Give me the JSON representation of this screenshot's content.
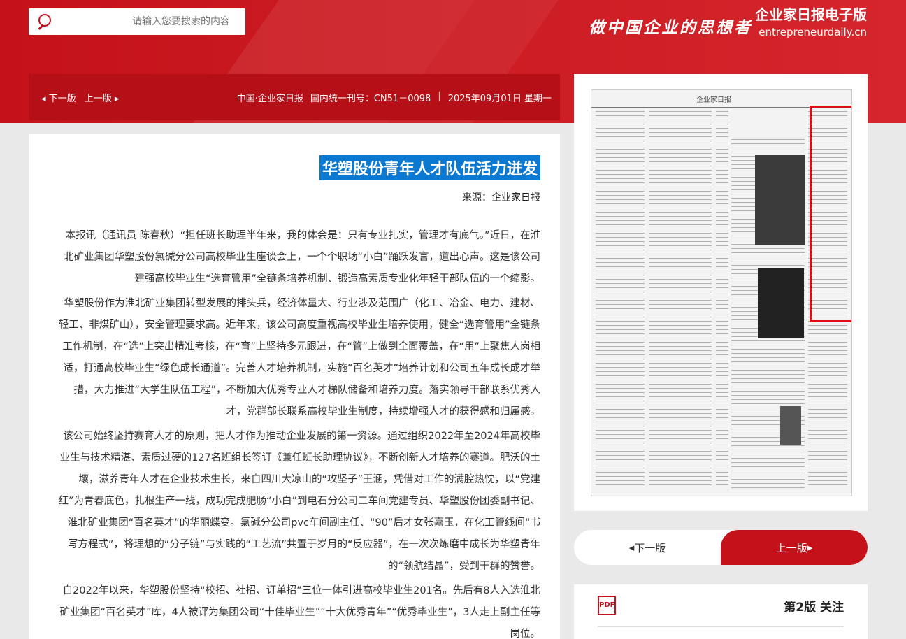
{
  "header": {
    "search_placeholder": "请输入您要搜索的内容",
    "brand_name": "企业家日报电子版",
    "brand_domain": "entrepreneurdaily.cn",
    "slogan": "做中国企业的思想者"
  },
  "infobar": {
    "prev_label": "上一版",
    "next_label": "下一版",
    "date": "2025年09月01日 星期一",
    "issn": "国内统一刊号：CN51－0098",
    "paper": "中国·企业家日报"
  },
  "article": {
    "title": "华塑股份青年人才队伍活力迸发",
    "source": "来源：企业家日报",
    "paragraphs": [
      "本报讯（通讯员 陈春秋）“担任班长助理半年来，我的体会是：只有专业扎实，管理才有底气。”近日，在淮北矿业集团华塑股份氯碱分公司高校毕业生座谈会上，一个个职场“小白”踊跃发言，道出心声。这是该公司建强高校毕业生“选育管用”全链条培养机制、锻造高素质专业化年轻干部队伍的一个缩影。",
      "华塑股份作为淮北矿业集团转型发展的排头兵，经济体量大、行业涉及范围广（化工、冶金、电力、建材、轻工、非煤矿山），安全管理要求高。近年来，该公司高度重视高校毕业生培养使用，健全“选育管用”全链条工作机制，在“选”上突出精准考核，在“育”上坚持多元跟进，在“管”上做到全面覆盖，在“用”上聚焦人岗相适，打通高校毕业生“绿色成长通道”。完善人才培养机制，实施“百名英才”培养计划和公司五年成长成才举措，大力推进“大学生队伍工程”，不断加大优秀专业人才梯队储备和培养力度。落实领导干部联系优秀人才，党群部长联系高校毕业生制度，持续增强人才的获得感和归属感。",
      "该公司始终坚持赛育人才的原则，把人才作为推动企业发展的第一资源。通过组织2022年至2024年高校毕业生与技术精湛、素质过硬的127名班组长签订《兼任班长助理协议》，不断创新人才培养的赛道。肥沃的土壤，滋养青年人才在企业技术生长，来自四川大凉山的“攻坚子”王涵，凭借对工作的满腔热忱，以“党建红”为青春底色，扎根生产一线，成功完成肥肠“小白”到电石分公司二车间党建专员、华塑股份团委副书记、淮北矿业集团“百名英才”的华丽蝶变。氯碱分公司pvc车间副主任、“90”后才女张嘉玉，在化工管线间“书写方程式”，将理想的“分子链”与实践的“工艺流”共置于岁月的“反应器”，在一次次炼磨中成长为华塑青年的“领航结晶”，受到干群的赞誉。",
      "自2022年以来，华塑股份坚持“校招、社招、订单招”三位一体引进高校毕业生201名。先后有8人入选淮北矿业集团“百名英才”库，4人被评为集团公司“十佳毕业生”“十大优秀青年”“优秀毕业生”，3人走上副主任等岗位。"
    ]
  },
  "sidebar": {
    "paper_header": "企业家日报",
    "pager_prev": "上一版",
    "pager_next": "下一版",
    "section_label": "第2版 关注",
    "pdf_label": "PDF"
  }
}
